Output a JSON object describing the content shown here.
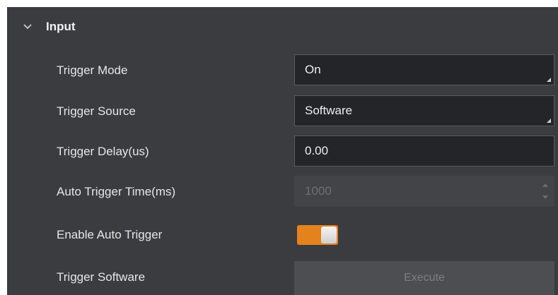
{
  "section": {
    "title": "Input"
  },
  "rows": [
    {
      "label": "Trigger Mode",
      "value": "On"
    },
    {
      "label": "Trigger Source",
      "value": "Software"
    },
    {
      "label": "Trigger Delay(us)",
      "value": "0.00"
    },
    {
      "label": "Auto Trigger Time(ms)",
      "value": "1000"
    },
    {
      "label": "Enable Auto Trigger",
      "toggle_state": "on"
    },
    {
      "label": "Trigger Software",
      "button_label": "Execute"
    }
  ],
  "colors": {
    "panel_bg": "#3b3c3f",
    "field_bg": "#242528",
    "accent": "#e6821e",
    "text": "#e6e6e6",
    "disabled_text": "#6e6f73"
  },
  "icons": {
    "section_toggle": "chevron-down-icon",
    "select_corner": "dropdown-corner-icon",
    "spinner": "spinner-arrows-icon"
  }
}
